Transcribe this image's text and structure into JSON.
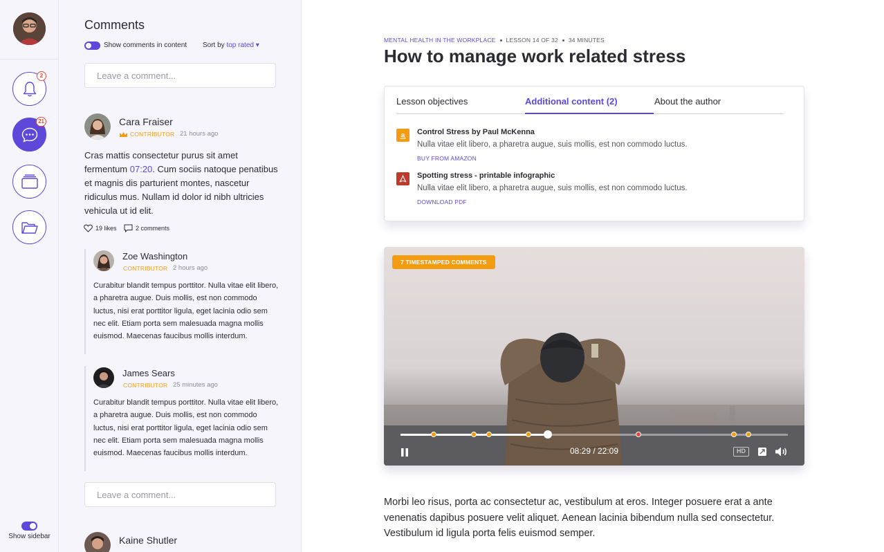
{
  "rail": {
    "notif_badge": "2",
    "comments_badge": "21",
    "show_sidebar_label": "Show sidebar"
  },
  "comments": {
    "heading": "Comments",
    "show_label": "Show comments in content",
    "sort_label": "Sort by",
    "sort_value": "top rated ▾",
    "input_placeholder": "Leave a comment...",
    "main": {
      "name": "Cara Fraiser",
      "role": "CONTRIBUTOR",
      "time": "21 hours ago",
      "body_before": "Cras mattis consectetur purus sit amet fermentum ",
      "timestamp": "07:20",
      "body_after": ". Cum sociis natoque penatibus et magnis dis parturient montes, nascetur ridiculus mus. Nullam id dolor id nibh ultricies vehicula ut id elit.",
      "likes": "19 likes",
      "replies": "2 comments"
    },
    "reply1": {
      "name": "Zoe Washington",
      "role": "CONTRIBUTOR",
      "time": "2 hours ago",
      "body": "Curabitur blandit tempus porttitor. Nulla vitae elit libero, a pharetra augue. Duis mollis, est non commodo luctus, nisi erat porttitor ligula, eget lacinia odio sem nec elit. Etiam porta sem malesuada magna mollis euismod. Maecenas faucibus mollis interdum."
    },
    "reply2": {
      "name": "James Sears",
      "role": "CONTRIBUTOR",
      "time": "25 minutes ago",
      "body": "Curabitur blandit tempus porttitor. Nulla vitae elit libero, a pharetra augue. Duis mollis, est non commodo luctus, nisi erat porttitor ligula, eget lacinia odio sem nec elit. Etiam porta sem malesuada magna mollis euismod. Maecenas faucibus mollis interdum."
    },
    "next": {
      "name": "Kaine Shutler"
    }
  },
  "lesson": {
    "course": "MENTAL HEALTH IN THE WORKPLACE",
    "lesson_no": "LESSON 14 OF 32",
    "duration": "34 MINUTES",
    "title": "How to manage work related stress",
    "tabs": [
      "Lesson objectives",
      "Additional content (2)",
      "About the author"
    ],
    "items": [
      {
        "title": "Control Stress by Paul McKenna",
        "desc": "Nulla vitae elit libero, a pharetra augue, suis mollis, est non commodo luctus.",
        "link": "BUY FROM AMAZON",
        "icon": "amazon-icon"
      },
      {
        "title": "Spotting stress - printable infographic",
        "desc": "Nulla vitae elit libero, a pharetra augue, suis mollis, est non commodo luctus.",
        "link": "DOWNLOAD PDF",
        "icon": "pdf-icon"
      }
    ],
    "video": {
      "badge": "7 TIMESTAMPED COMMENTS",
      "time": "08:29 / 22:09",
      "progress": 0.38,
      "markers": [
        0.085,
        0.19,
        0.228,
        0.33,
        0.615,
        0.86,
        0.898
      ],
      "red_markers": [
        0.615
      ],
      "hd_label": "HD"
    },
    "body": "Morbi leo risus, porta ac consectetur ac, vestibulum at eros. Integer posuere erat a ante venenatis dapibus posuere velit aliquet. Aenean lacinia bibendum nulla sed consectetur. Vestibulum id ligula porta felis euismod semper."
  },
  "colors": {
    "accent": "#5d48d9",
    "orange": "#f39c12",
    "red": "#e24b3b"
  }
}
